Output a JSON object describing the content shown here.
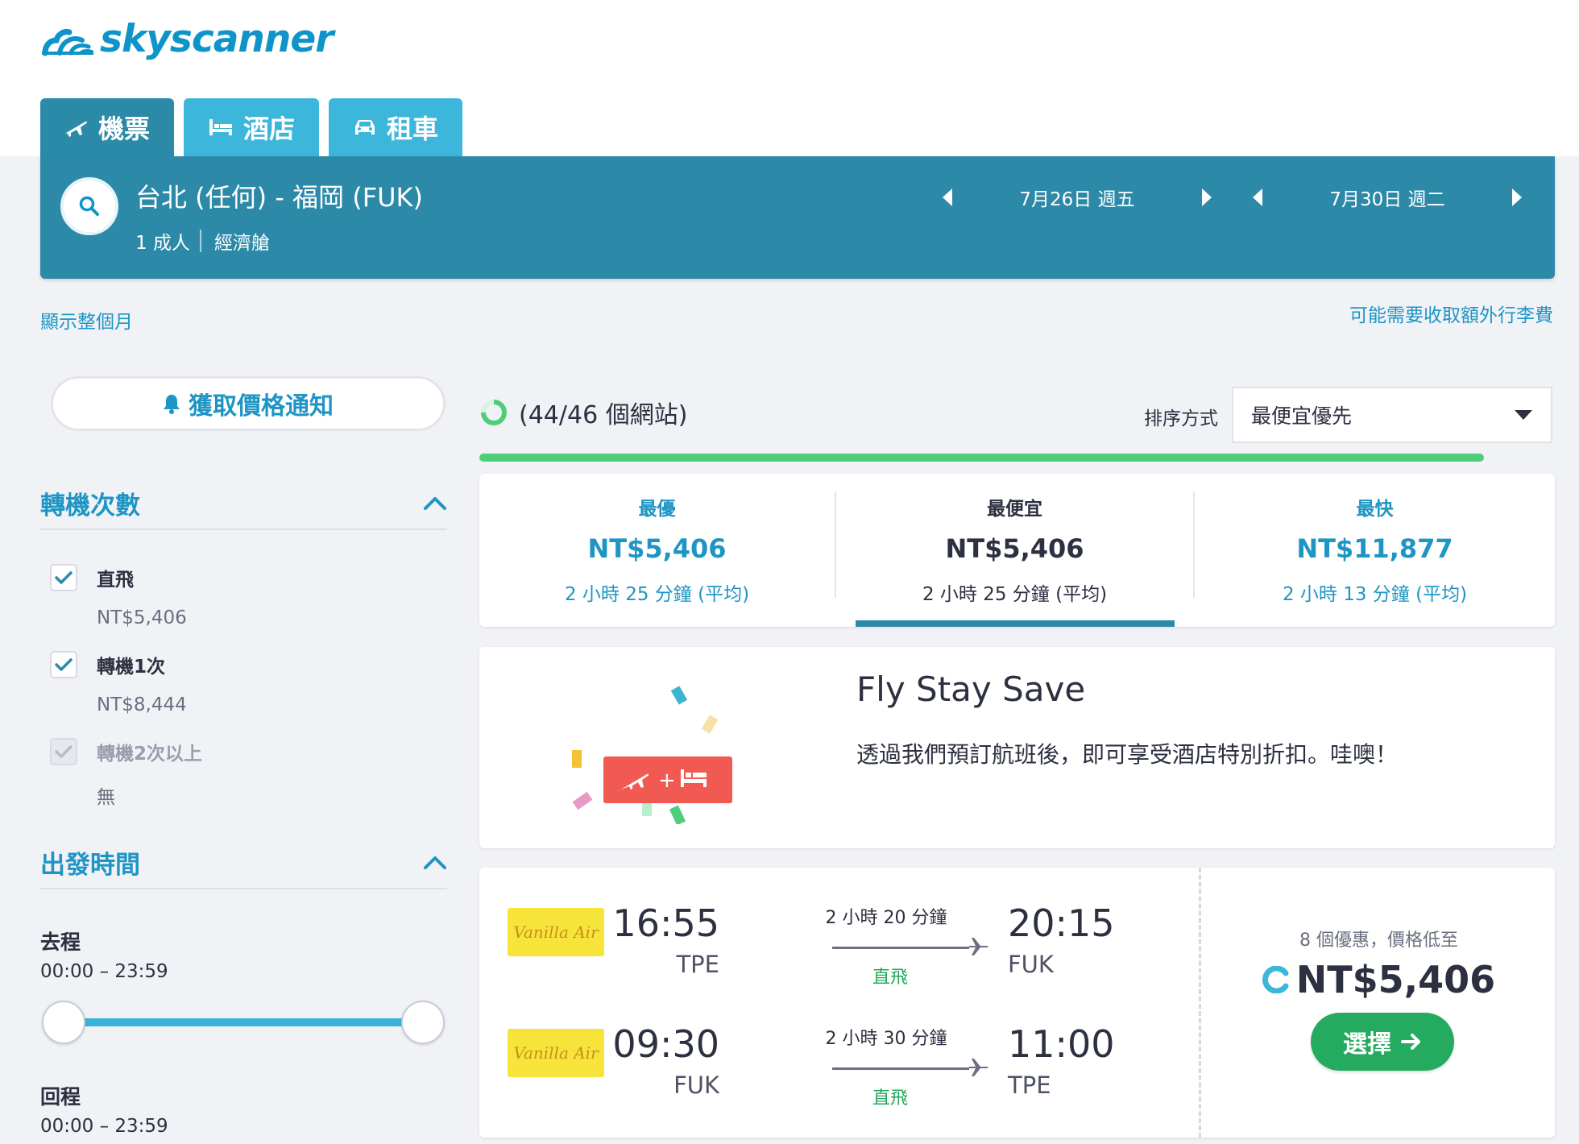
{
  "brand": {
    "name": "skyscanner"
  },
  "tabs": [
    {
      "label": "機票",
      "icon": "plane-icon"
    },
    {
      "label": "酒店",
      "icon": "bed-icon"
    },
    {
      "label": "租車",
      "icon": "car-icon"
    }
  ],
  "search": {
    "route": "台北 (任何) - 福岡 (FUK)",
    "passengers": "1 成人",
    "cabin": "經濟艙",
    "depart_date": "7月26日 週五",
    "return_date": "7月30日 週二"
  },
  "links": {
    "show_month": "顯示整個月",
    "baggage": "可能需要收取額外行李費"
  },
  "sidebar": {
    "alert_label": "獲取價格通知",
    "stops_title": "轉機次數",
    "stops": [
      {
        "label": "直飛",
        "price": "NT$5,406",
        "checked": true
      },
      {
        "label": "轉機1次",
        "price": "NT$8,444",
        "checked": true
      },
      {
        "label": "轉機2次以上",
        "price": "無",
        "checked": true,
        "disabled": true
      }
    ],
    "time_title": "出發時間",
    "outbound_label": "去程",
    "outbound_range": "00:00 – 23:59",
    "return_label": "回程",
    "return_range": "00:00 – 23:59"
  },
  "results_header": {
    "status": "(44/46 個網站)",
    "sort_label": "排序方式",
    "sort_value": "最便宜優先"
  },
  "summary": [
    {
      "heading": "最優",
      "price": "NT$5,406",
      "duration": "2 小時 25 分鐘 (平均)"
    },
    {
      "heading": "最便宜",
      "price": "NT$5,406",
      "duration": "2 小時 25 分鐘 (平均)"
    },
    {
      "heading": "最快",
      "price": "NT$11,877",
      "duration": "2 小時 13 分鐘 (平均)"
    }
  ],
  "promo": {
    "title": "Fly Stay Save",
    "description": "透過我們預訂航班後，即可享受酒店特別折扣。哇噢！"
  },
  "result": {
    "legs": [
      {
        "airline": "Vanilla Air",
        "dep_time": "16:55",
        "dep_code": "TPE",
        "duration": "2 小時 20 分鐘",
        "stops": "直飛",
        "arr_time": "20:15",
        "arr_code": "FUK"
      },
      {
        "airline": "Vanilla Air",
        "dep_time": "09:30",
        "dep_code": "FUK",
        "duration": "2 小時 30 分鐘",
        "stops": "直飛",
        "arr_time": "11:00",
        "arr_code": "TPE"
      }
    ],
    "deals": "8 個優惠，價格低至",
    "price": "NT$5,406",
    "select_label": "選擇"
  },
  "colors": {
    "brand_blue": "#0e94c9",
    "header_teal": "#2c8aa8",
    "tab_light": "#3db6dc",
    "link_blue": "#1e95c4",
    "green": "#24ab5f"
  }
}
